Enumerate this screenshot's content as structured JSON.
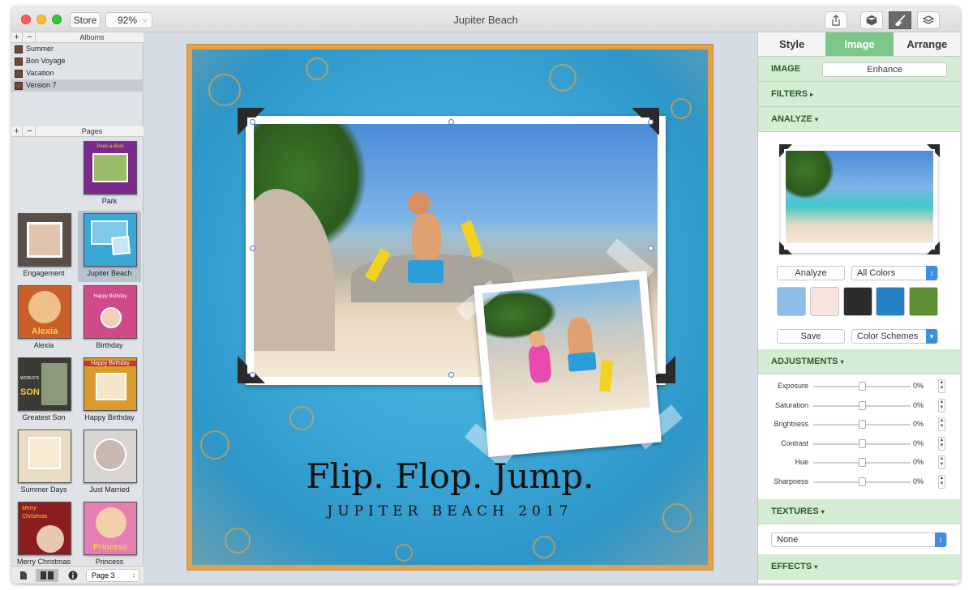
{
  "window": {
    "title": "Jupiter Beach"
  },
  "toolbar": {
    "store_label": "Store",
    "zoom": "92%"
  },
  "sidebar": {
    "albums_header": "Albums",
    "albums": [
      {
        "label": "Summer"
      },
      {
        "label": "Bon Voyage"
      },
      {
        "label": "Vacation"
      },
      {
        "label": "Version 7"
      }
    ],
    "pages_header": "Pages",
    "pages": [
      {
        "label": "Park",
        "color": "#7a2a8a"
      },
      {
        "label": "Engagement",
        "color": "#5b4e48"
      },
      {
        "label": "Jupiter Beach",
        "color": "#3aa7d4"
      },
      {
        "label": "Alexia",
        "color": "#c9602a"
      },
      {
        "label": "Birthday",
        "color": "#d04a8a"
      },
      {
        "label": "Greatest Son",
        "color": "#3c3a35"
      },
      {
        "label": "Happy Birthday",
        "color": "#d99a2e"
      },
      {
        "label": "Summer Days",
        "color": "#e9dcc2"
      },
      {
        "label": "Just Married",
        "color": "#d8d4d2"
      },
      {
        "label": "Merry Christmas",
        "color": "#8a1e1e"
      },
      {
        "label": "Princess",
        "color": "#e57fb2"
      }
    ],
    "thumb_texts": {
      "park": "Peek-a-Boo!",
      "alexia": "Alexia",
      "birthday": "Happy Birthday",
      "son_top": "WORLD'S",
      "son_main": "SON",
      "happy_birthday": "Happy Birthday",
      "merry": "Merry",
      "christmas": "Christmas",
      "princess": "Princess"
    },
    "page_selector": "Page 3"
  },
  "canvas": {
    "headline": "Flip. Flop. Jump.",
    "subheadline": "JUPITER BEACH 2017"
  },
  "inspector": {
    "tabs": [
      {
        "label": "Style"
      },
      {
        "label": "Image"
      },
      {
        "label": "Arrange"
      }
    ],
    "image_label": "IMAGE",
    "enhance_label": "Enhance",
    "filters_label": "FILTERS",
    "analyze_label": "ANALYZE",
    "analyze_button": "Analyze",
    "colors_select": "All Colors",
    "swatches": [
      "#8fbfe8",
      "#f7e4dc",
      "#2b2b2b",
      "#2481c3",
      "#5e8f33"
    ],
    "save_button": "Save",
    "schemes_select": "Color Schemes",
    "adjustments_label": "ADJUSTMENTS",
    "adjustments": [
      {
        "label": "Exposure",
        "value": "0%"
      },
      {
        "label": "Saturation",
        "value": "0%"
      },
      {
        "label": "Brightness",
        "value": "0%"
      },
      {
        "label": "Contrast",
        "value": "0%"
      },
      {
        "label": "Hue",
        "value": "0%"
      },
      {
        "label": "Sharpness",
        "value": "0%"
      }
    ],
    "textures_label": "TEXTURES",
    "texture_select": "None",
    "effects_label": "EFFECTS"
  }
}
